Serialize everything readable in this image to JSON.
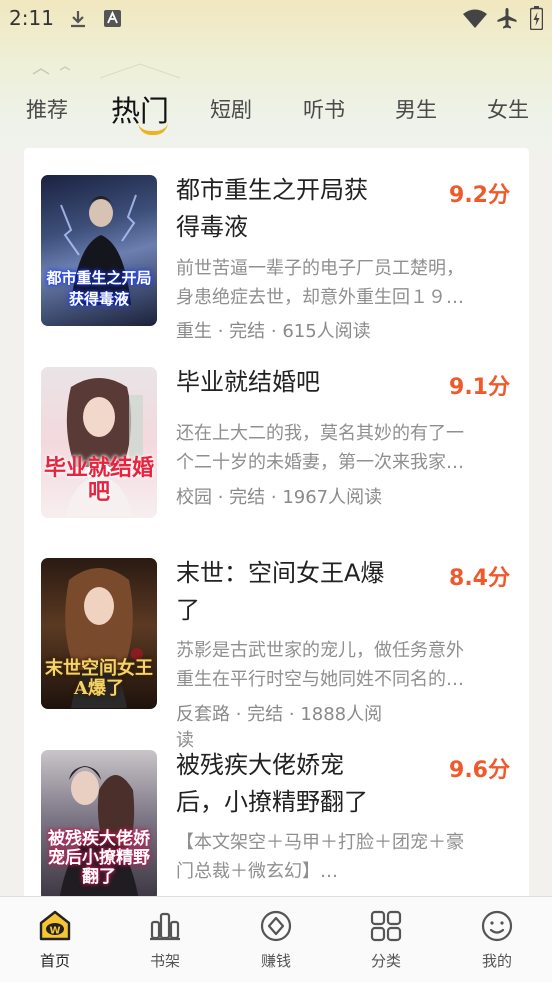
{
  "status_bar": {
    "time": "2:11"
  },
  "tabs": [
    {
      "label": "推荐"
    },
    {
      "label": "热门"
    },
    {
      "label": "短剧"
    },
    {
      "label": "听书"
    },
    {
      "label": "男生"
    },
    {
      "label": "女生"
    }
  ],
  "active_tab": "热门",
  "books": [
    {
      "title_line1": "都市重生之开局获",
      "title_line2": "得毒液",
      "score": "9.2分",
      "desc_line1": "前世苦逼一辈子的电子厂员工楚明，",
      "desc_line2": "身患绝症去世，却意外重生回１９…",
      "meta_line1": "重生 · 完结 · 615人阅读",
      "meta_line2": "",
      "cover_text": "都市重生之开局获得毒液"
    },
    {
      "title_line1": "毕业就结婚吧",
      "title_line2": "",
      "score": "9.1分",
      "desc_line1": "还在上大二的我，莫名其妙的有了一",
      "desc_line2": "个二十岁的未婚妻，第一次来我家…",
      "meta_line1": "校园 · 完结 · 1967人阅读",
      "meta_line2": "",
      "cover_text": "毕业就结婚吧"
    },
    {
      "title_line1": "末世：空间女王A爆",
      "title_line2": "了",
      "score": "8.4分",
      "desc_line1": "苏影是古武世家的宠儿，做任务意外",
      "desc_line2": "重生在平行时空与她同姓不同名的…",
      "meta_line1": "反套路 · 完结 · 1888人阅",
      "meta_line2": "读",
      "cover_text": "末世空间女王A爆了"
    },
    {
      "title_line1": "被残疾大佬娇宠",
      "title_line2": "后，小撩精野翻了",
      "score": "9.6分",
      "desc_line1": "【本文架空＋马甲＋打脸＋团宠＋豪",
      "desc_line2": "门总裁＋微玄幻】…",
      "meta_line1": "",
      "meta_line2": "",
      "cover_text": "被残疾大佬娇宠后小撩精野翻了"
    }
  ],
  "bottom_nav": [
    {
      "label": "首页",
      "icon": "home-icon"
    },
    {
      "label": "书架",
      "icon": "bookshelf-icon"
    },
    {
      "label": "赚钱",
      "icon": "earn-coin-icon"
    },
    {
      "label": "分类",
      "icon": "category-grid-icon"
    },
    {
      "label": "我的",
      "icon": "smiley-profile-icon"
    }
  ],
  "colors": {
    "accent": "#f0592b",
    "tab_underline": "#e9b41f",
    "home_icon_yellow": "#f6c533",
    "text_dark": "#222222",
    "text_gray": "#8f8f8f"
  }
}
